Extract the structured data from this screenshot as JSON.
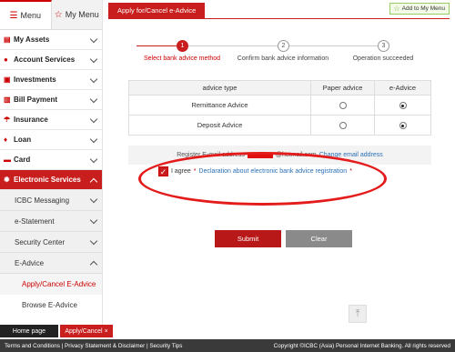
{
  "sidebar": {
    "tabs": [
      {
        "label": "Menu",
        "icon": "list-icon"
      },
      {
        "label": "My Menu",
        "icon": "star-icon"
      }
    ],
    "items": [
      {
        "label": "My Assets",
        "icon": "document-icon"
      },
      {
        "label": "Account Services",
        "icon": "person-icon"
      },
      {
        "label": "Investments",
        "icon": "chart-icon"
      },
      {
        "label": "Bill Payment",
        "icon": "bill-icon"
      },
      {
        "label": "Insurance",
        "icon": "umbrella-icon"
      },
      {
        "label": "Loan",
        "icon": "money-bag-icon"
      },
      {
        "label": "Card",
        "icon": "card-icon"
      },
      {
        "label": "Electronic Services",
        "icon": "gear-icon"
      }
    ],
    "sub_items": [
      {
        "label": "ICBC Messaging"
      },
      {
        "label": "e-Statement"
      },
      {
        "label": "Security Center"
      },
      {
        "label": "E-Advice"
      }
    ],
    "sub2_items": [
      {
        "label": "Apply/Cancel E-Advice"
      },
      {
        "label": "Browse E-Advice"
      }
    ]
  },
  "bottom_tabs": {
    "home": "Home page",
    "current": "Apply/Cancel",
    "close": "×"
  },
  "footer": {
    "links": "Terms and Conditions | Privacy Statement & Disclaimer | Security Tips",
    "copyright": "Copyright ©ICBC (Asia) Personal Internet Banking. All rights reserved"
  },
  "header": {
    "page_tab": "Apply for/Cancel e-Advice",
    "add_to_my_menu": "Add to My Menu"
  },
  "steps": [
    {
      "number": "1",
      "label": "Select bank advice method"
    },
    {
      "number": "2",
      "label": "Confirm bank advice information"
    },
    {
      "number": "3",
      "label": "Operation succeeded"
    }
  ],
  "table": {
    "headers": [
      "advice type",
      "Paper advice",
      "e-Advice"
    ],
    "rows": [
      {
        "type": "Remittance Advice",
        "paper": false,
        "eadvice": true
      },
      {
        "type": "Deposit Advice",
        "paper": false,
        "eadvice": true
      }
    ]
  },
  "register": {
    "prefix": "Register E-mail address",
    "email_suffix": "@hotmail.com",
    "change_link": "Change email address"
  },
  "agree": {
    "text": "I agree",
    "link": "Declaration about electronic bank advice registration",
    "required_mark": "*"
  },
  "buttons": {
    "submit": "Submit",
    "clear": "Clear"
  },
  "colors": {
    "brand": "#c81e1e",
    "link": "#2a6fb5",
    "highlight": "#e41b1b"
  }
}
